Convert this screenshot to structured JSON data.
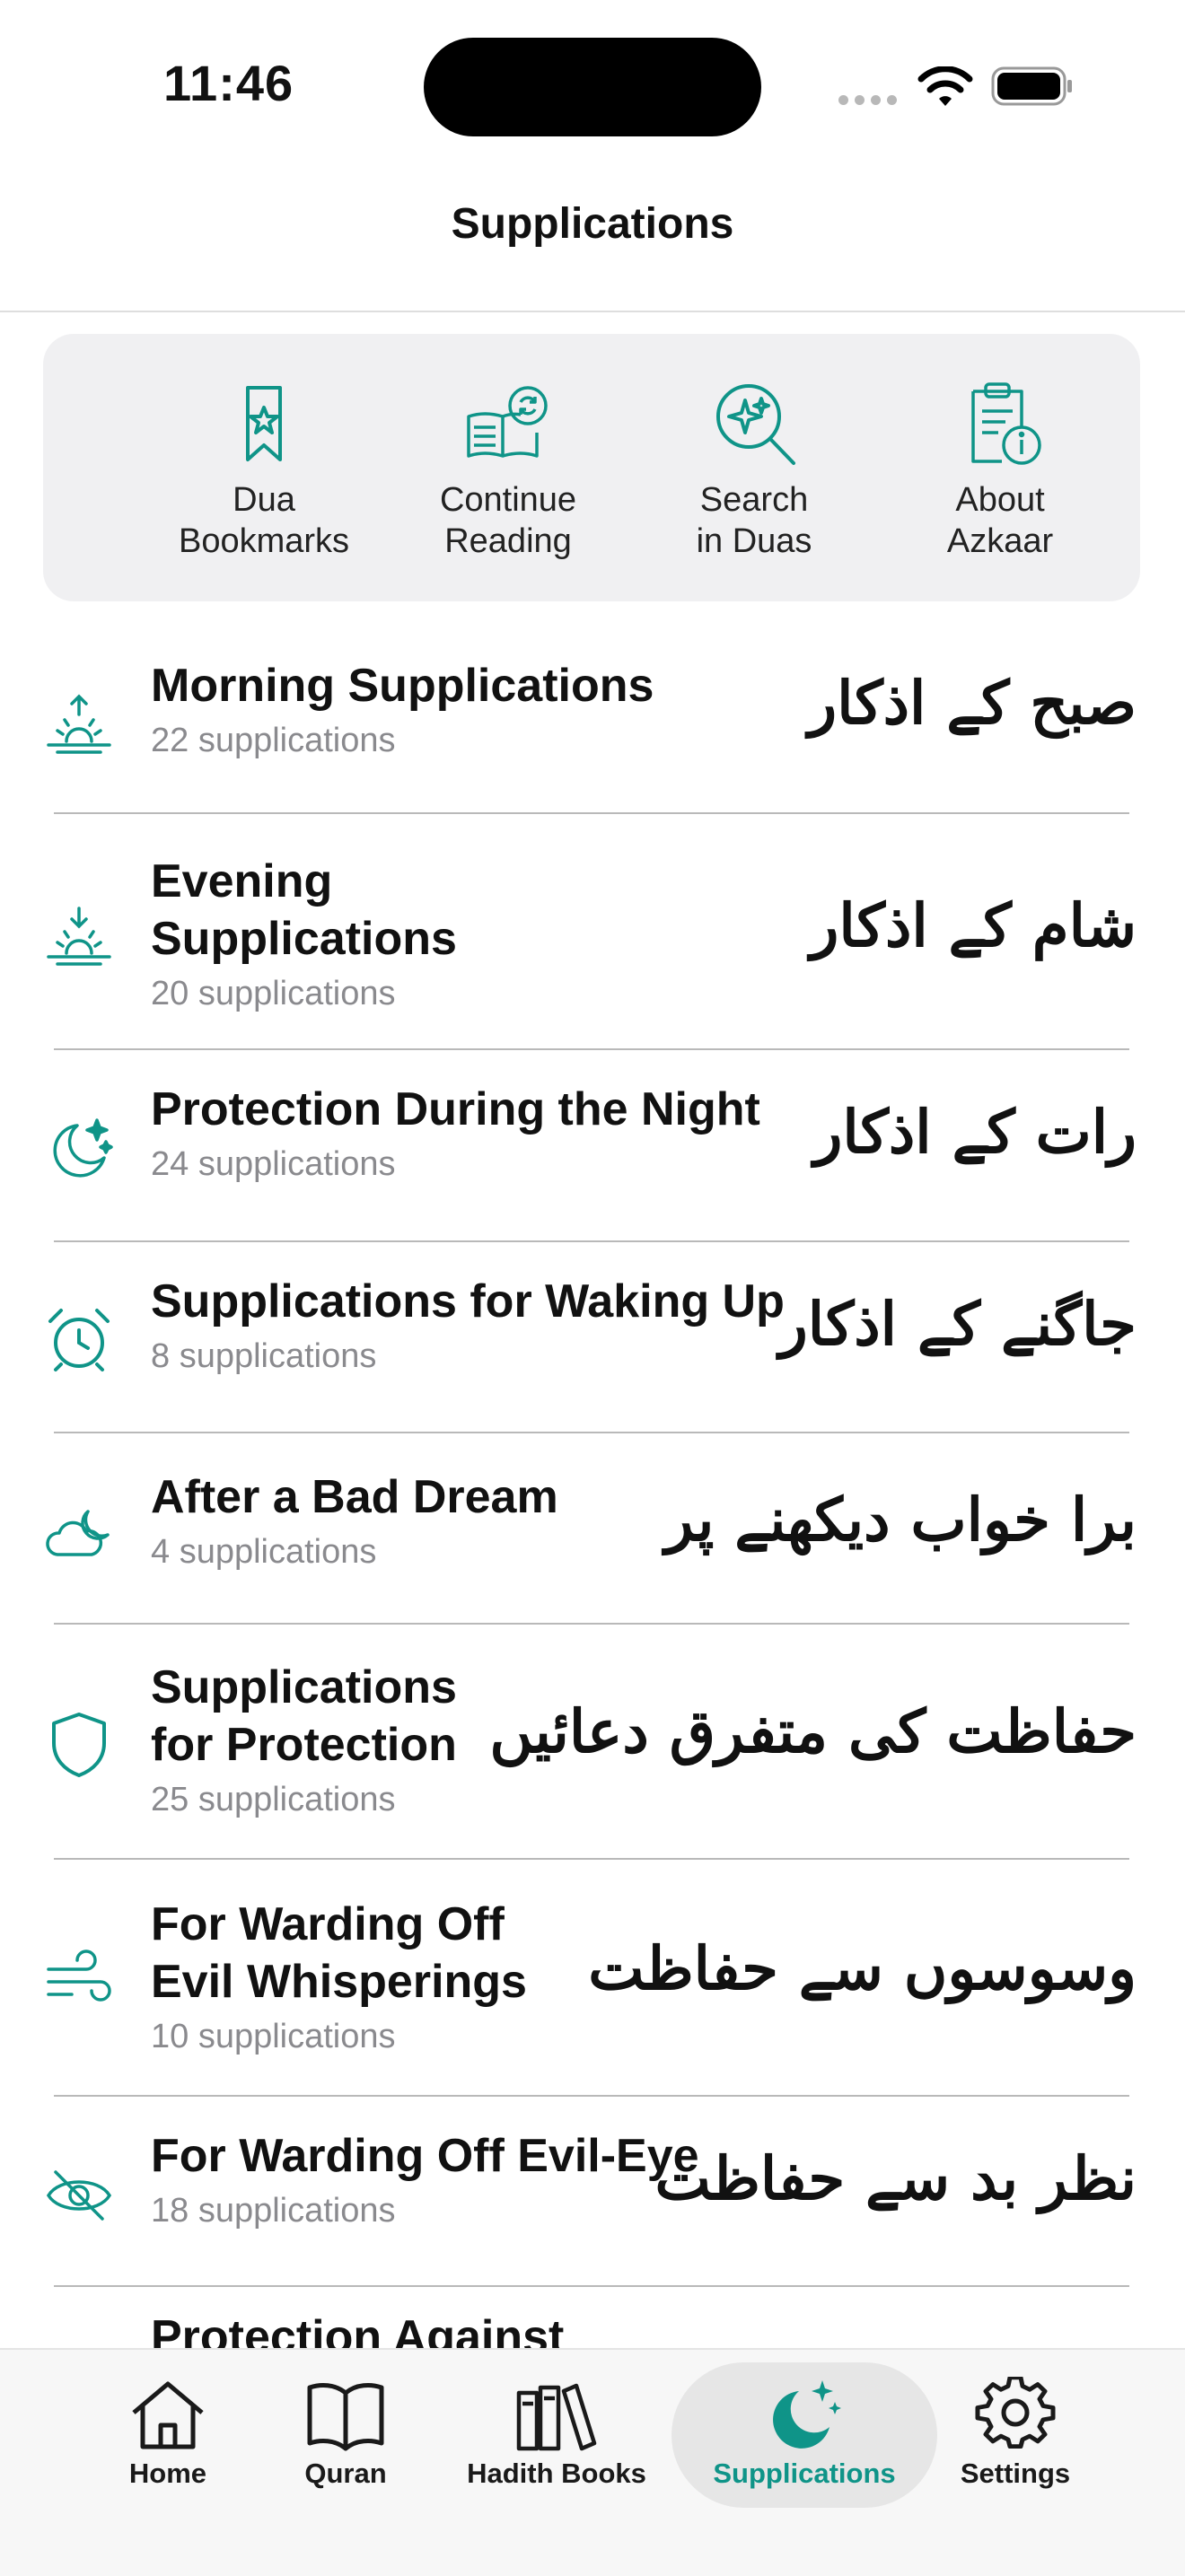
{
  "status_bar": {
    "time": "11:46"
  },
  "header": {
    "title": "Supplications"
  },
  "quick_actions": [
    {
      "label": "Dua\nBookmarks",
      "icon": "bookmark-star-icon"
    },
    {
      "label": "Continue\nReading",
      "icon": "book-refresh-icon"
    },
    {
      "label": "Search\nin Duas",
      "icon": "search-sparkle-icon"
    },
    {
      "label": "About\nAzkaar",
      "icon": "clipboard-info-icon"
    }
  ],
  "categories": [
    {
      "title": "Morning Supplications",
      "count": "22 supplications",
      "urdu": "صبح کے اذکار",
      "icon": "sunrise-icon"
    },
    {
      "title": "Evening\nSupplications",
      "count": "20 supplications",
      "urdu": "شام کے اذکار",
      "icon": "sunset-icon"
    },
    {
      "title": "Protection During the Night",
      "count": "24 supplications",
      "urdu": "رات کے اذکار",
      "icon": "moon-stars-icon"
    },
    {
      "title": "Supplications for Waking Up",
      "count": "8 supplications",
      "urdu": "جاگنے کے اذکار",
      "icon": "alarm-clock-icon"
    },
    {
      "title": "After a Bad Dream",
      "count": "4 supplications",
      "urdu": "برا خواب دیکھنے پر",
      "icon": "cloud-moon-icon"
    },
    {
      "title": "Supplications\nfor Protection",
      "count": "25 supplications",
      "urdu": "حفاظت کی متفرق دعائیں",
      "icon": "shield-icon"
    },
    {
      "title": "For Warding Off\nEvil Whisperings",
      "count": "10 supplications",
      "urdu": "وسوسوں سے حفاظت",
      "icon": "wind-icon"
    },
    {
      "title": "For Warding Off Evil-Eye",
      "count": "18 supplications",
      "urdu": "نظر بد سے حفاظت",
      "icon": "eye-slash-icon"
    }
  ],
  "partial_row_title": "Protection Against",
  "tabs": [
    {
      "label": "Home",
      "icon": "house-icon",
      "active": false
    },
    {
      "label": "Quran",
      "icon": "open-book-icon",
      "active": false
    },
    {
      "label": "Hadith Books",
      "icon": "books-icon",
      "active": false
    },
    {
      "label": "Supplications",
      "icon": "moon-stars-icon",
      "active": true
    },
    {
      "label": "Settings",
      "icon": "gear-icon",
      "active": false
    }
  ],
  "colors": {
    "accent": "#0f9488",
    "card_bg": "#f0f0f2",
    "secondary_text": "#8a8a8e"
  }
}
